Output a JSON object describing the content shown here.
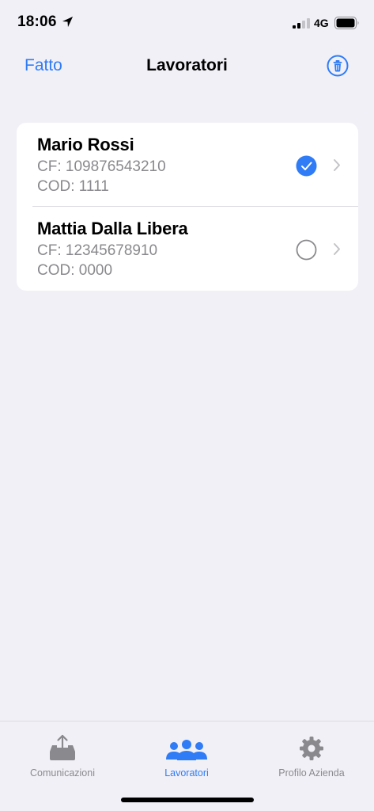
{
  "status_bar": {
    "time": "18:06",
    "network": "4G",
    "icons": [
      "location-arrow-icon",
      "signal-bars-icon",
      "battery-icon"
    ]
  },
  "nav": {
    "left_label": "Fatto",
    "title": "Lavoratori",
    "right_icon": "trash-icon",
    "accent_color": "#2f7cf6"
  },
  "workers": [
    {
      "name": "Mario Rossi",
      "cf": "CF: 109876543210",
      "cod": "COD: 1111",
      "selected": true
    },
    {
      "name": "Mattia Dalla Libera",
      "cf": "CF: 12345678910",
      "cod": "COD: 0000",
      "selected": false
    }
  ],
  "tabs": [
    {
      "label": "Comunicazioni",
      "icon": "tray-upload-icon",
      "active": false
    },
    {
      "label": "Lavoratori",
      "icon": "people-group-icon",
      "active": true
    },
    {
      "label": "Profilo Azienda",
      "icon": "gear-icon",
      "active": false
    }
  ]
}
